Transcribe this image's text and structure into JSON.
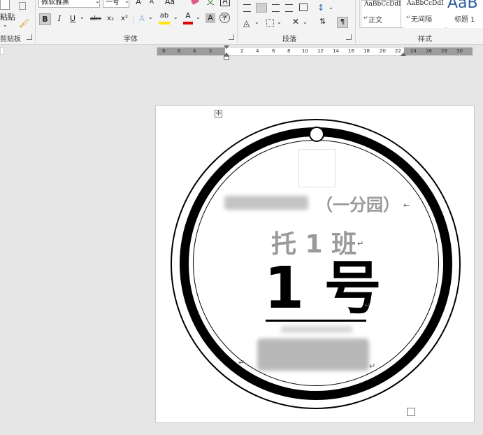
{
  "ribbon": {
    "clipboard": {
      "paste_label": "粘贴",
      "group_label": "剪贴板"
    },
    "font": {
      "font_name": "微软雅黑",
      "font_size": "一号",
      "group_label": "字体",
      "bold": "B",
      "italic": "I",
      "underline": "U",
      "strikethrough": "abc",
      "subscript": "x₂",
      "superscript": "x²",
      "grow": "A",
      "shrink": "A",
      "change_case": "Aa",
      "char_border": "A",
      "char_shading": "A",
      "enclose": "字",
      "phonetic": "文",
      "font_color": "A",
      "highlight": "ab"
    },
    "paragraph": {
      "group_label": "段落"
    },
    "styles": {
      "group_label": "样式",
      "items": [
        {
          "sample": "AaBbCcDdI",
          "name": "正文"
        },
        {
          "sample": "AaBbCcDdI",
          "name": "无间隔"
        },
        {
          "sample": "AaB",
          "name": "标题 1"
        }
      ]
    }
  },
  "ruler": {
    "left_numbers": [
      "8",
      "6",
      "4",
      "2"
    ],
    "right_numbers": [
      "2",
      "4",
      "6",
      "8",
      "10",
      "12",
      "14",
      "16",
      "18",
      "20",
      "22",
      "24",
      "26",
      "28",
      "30"
    ]
  },
  "document": {
    "school": "（一分园）",
    "class_name": "托 1 班",
    "number": "1 号",
    "return_mark": "↵",
    "paragraph_mark": "←"
  }
}
